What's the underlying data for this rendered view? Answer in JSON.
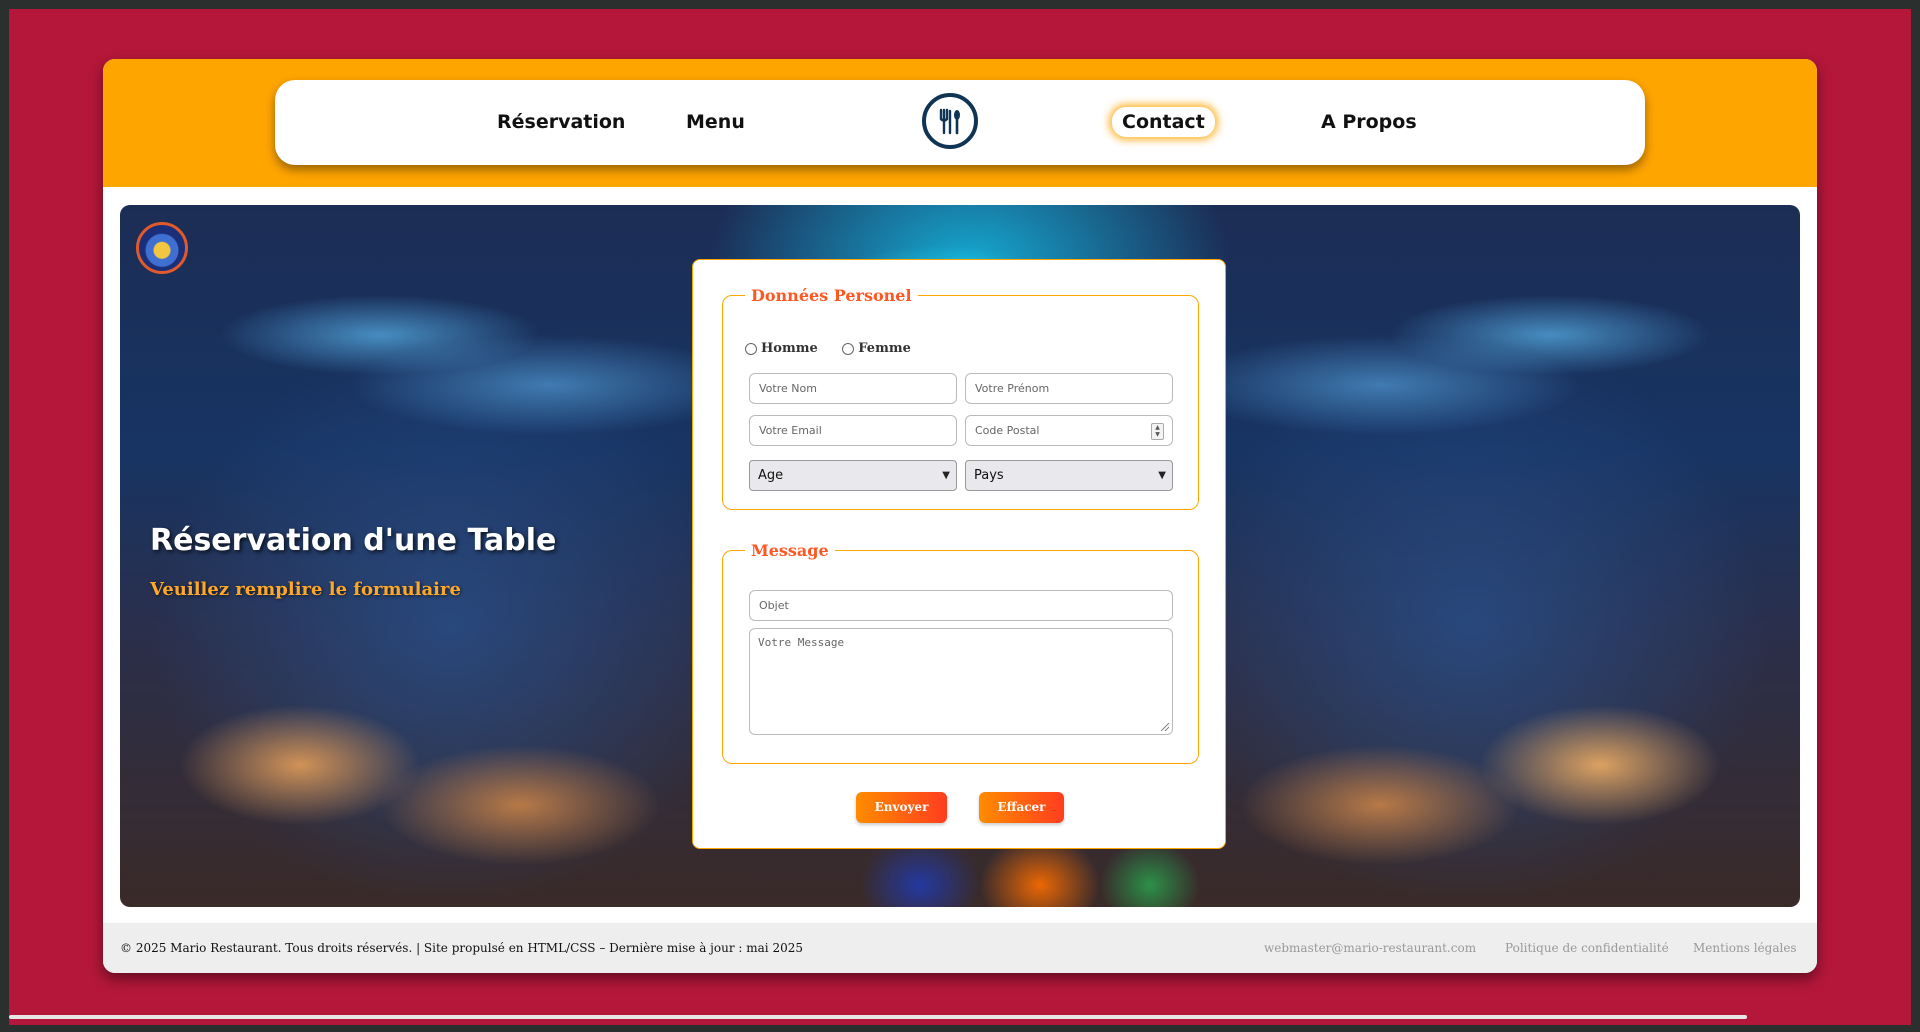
{
  "nav": {
    "items": [
      {
        "label": "Réservation"
      },
      {
        "label": "Menu"
      },
      {
        "label": "Contact",
        "active": true
      },
      {
        "label": "A Propos"
      }
    ],
    "logo_icon": "cutlery-icon"
  },
  "hero": {
    "title": "Réservation d'une Table",
    "subtitle": "Veuillez remplire le formulaire"
  },
  "form": {
    "personal": {
      "legend": "Données Personel",
      "gender_options": [
        "Homme",
        "Femme"
      ],
      "nom_placeholder": "Votre Nom",
      "prenom_placeholder": "Votre Prénom",
      "email_placeholder": "Votre Email",
      "postal_placeholder": "Code Postal",
      "age_selected": "Age",
      "pays_selected": "Pays"
    },
    "message": {
      "legend": "Message",
      "objet_placeholder": "Objet",
      "message_placeholder": "Votre Message"
    },
    "submit_label": "Envoyer",
    "reset_label": "Effacer"
  },
  "footer": {
    "copyright": "© 2025 Mario Restaurant. Tous droits réservés. | Site propulsé en HTML/CSS – Dernière mise à jour : mai 2025",
    "email": "webmaster@mario-restaurant.com",
    "privacy": "Politique de confidentialité",
    "legal": "Mentions légales"
  },
  "colors": {
    "page_bg": "#b5173a",
    "header_bg": "#ffa500",
    "accent": "#ff5722",
    "logo_ring": "#0f3454"
  }
}
